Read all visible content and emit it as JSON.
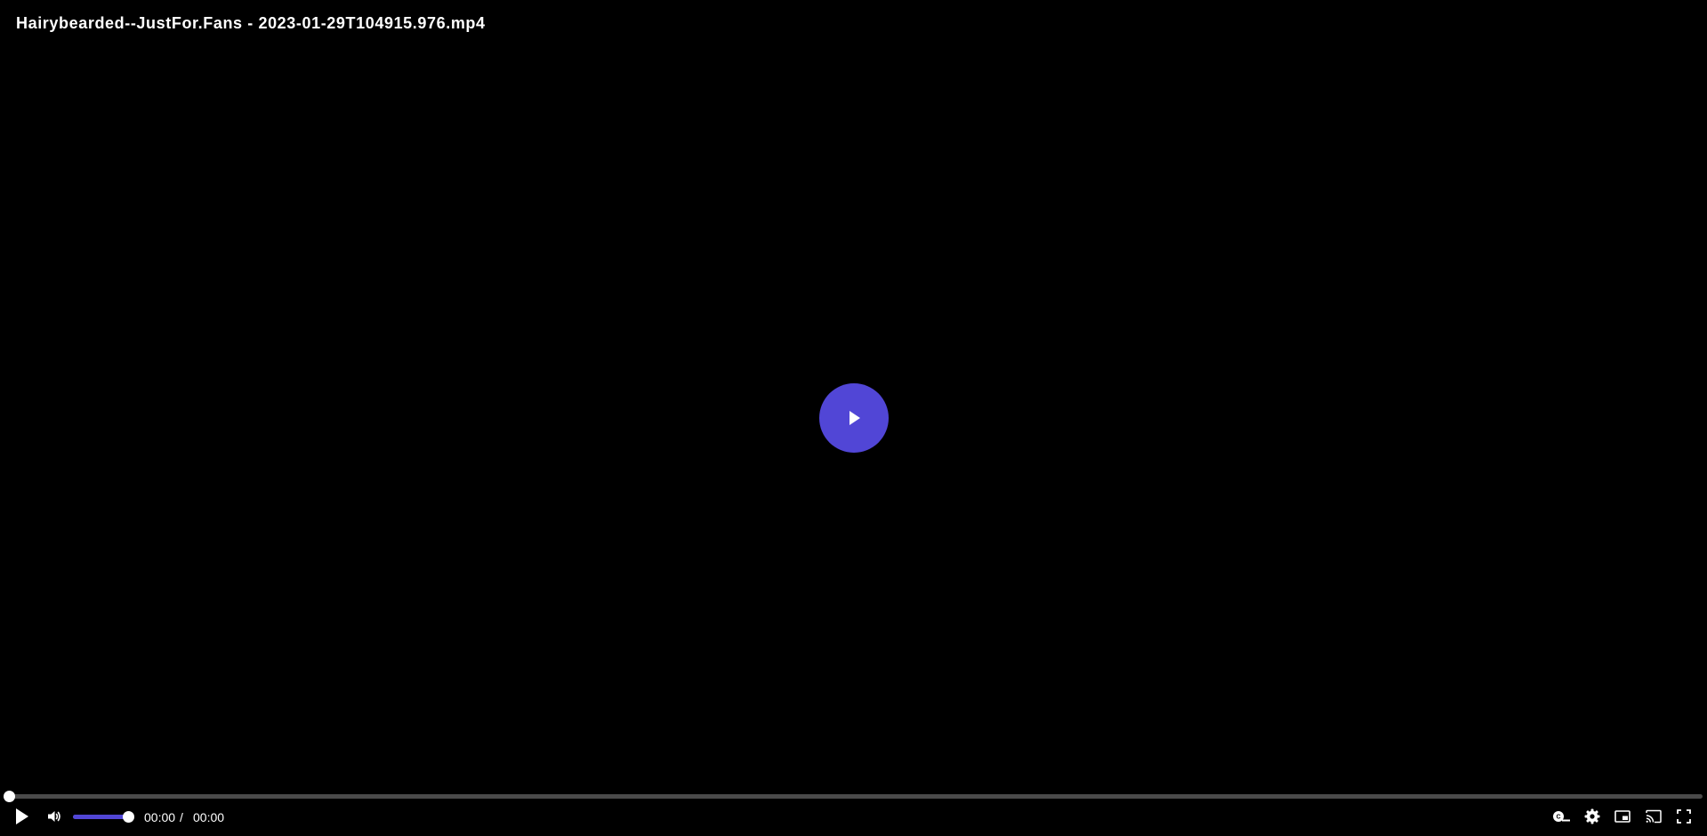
{
  "video": {
    "title": "Hairybearded--JustFor.Fans - 2023-01-29T104915.976.mp4"
  },
  "player": {
    "accent_color": "#5146d6",
    "playback_progress": 0,
    "volume_level": 1,
    "current_time": "00:00",
    "separator": "/",
    "duration": "00:00"
  },
  "icons": {
    "big_play": "play-icon",
    "play": "play-icon",
    "volume": "volume-icon",
    "captions": "captions-icon",
    "settings": "gear-icon",
    "pip": "picture-in-picture-icon",
    "cast": "cast-icon",
    "fullscreen": "fullscreen-icon"
  }
}
